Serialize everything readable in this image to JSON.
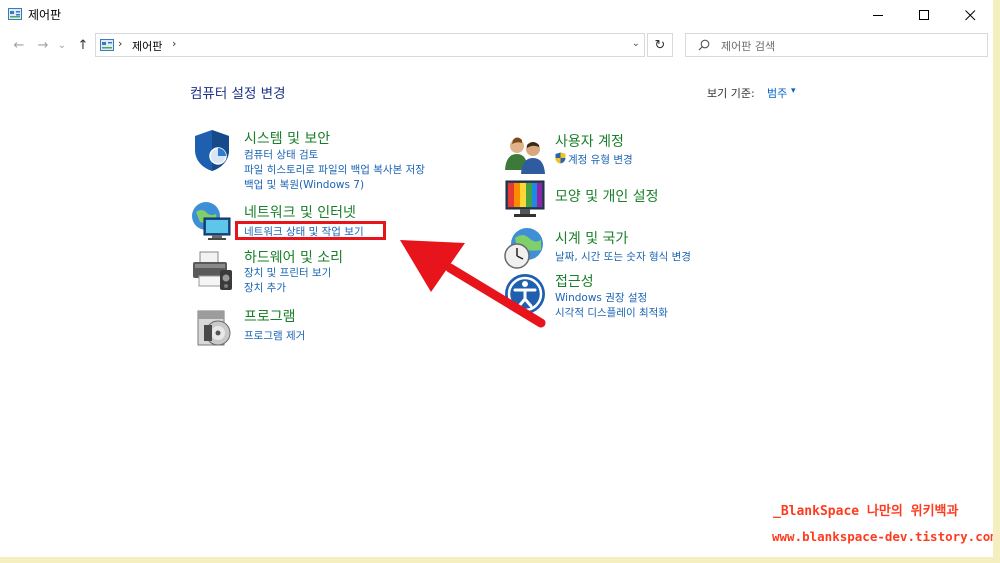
{
  "window": {
    "title": "제어판",
    "controls": {
      "minimize": "–",
      "maximize": "☐",
      "close": "✕"
    }
  },
  "address_bar": {
    "back": "←",
    "forward": "→",
    "recent": "⌄",
    "up": "↑",
    "separator": "›",
    "path": "제어판",
    "trailing_separator": "›",
    "dropdown": "⌄",
    "refresh": "↻"
  },
  "search": {
    "placeholder": "제어판 검색"
  },
  "main": {
    "heading": "컴퓨터 설정 변경",
    "view_by": {
      "label": "보기 기준:",
      "value": "범주",
      "caret": "▾"
    }
  },
  "categories_left": [
    {
      "title": "시스템 및 보안",
      "icon": "shield-icon",
      "links": [
        "컴퓨터 상태 검토",
        "파일 히스토리로 파일의 백업 복사본 저장",
        "백업 및 복원(Windows 7)"
      ]
    },
    {
      "title": "네트워크 및 인터넷",
      "icon": "network-globe-icon",
      "links": [
        "네트워크 상태 및 작업 보기"
      ]
    },
    {
      "title": "하드웨어 및 소리",
      "icon": "printer-icon",
      "links": [
        "장치 및 프린터 보기",
        "장치 추가"
      ]
    },
    {
      "title": "프로그램",
      "icon": "programs-disc-icon",
      "links": [
        "프로그램 제거"
      ]
    }
  ],
  "categories_right": [
    {
      "title": "사용자 계정",
      "icon": "users-icon",
      "links": [
        "계정 유형 변경"
      ]
    },
    {
      "title": "모양 및 개인 설정",
      "icon": "monitor-color-icon",
      "links": []
    },
    {
      "title": "시계 및 국가",
      "icon": "clock-globe-icon",
      "links": [
        "날짜, 시간 또는 숫자 형식 변경"
      ]
    },
    {
      "title": "접근성",
      "icon": "accessibility-icon",
      "links": [
        "Windows 권장 설정",
        "시각적 디스플레이 최적화"
      ]
    }
  ],
  "watermark": {
    "line1": "_BlankSpace 나만의 위키백과",
    "line2": "www.blankspace-dev.tistory.com"
  },
  "colors": {
    "category_title": "#1a7f2a",
    "link": "#1a64b4",
    "heading": "#1e3287",
    "annotation_red": "#e8141c",
    "background": "#f5eebf"
  }
}
